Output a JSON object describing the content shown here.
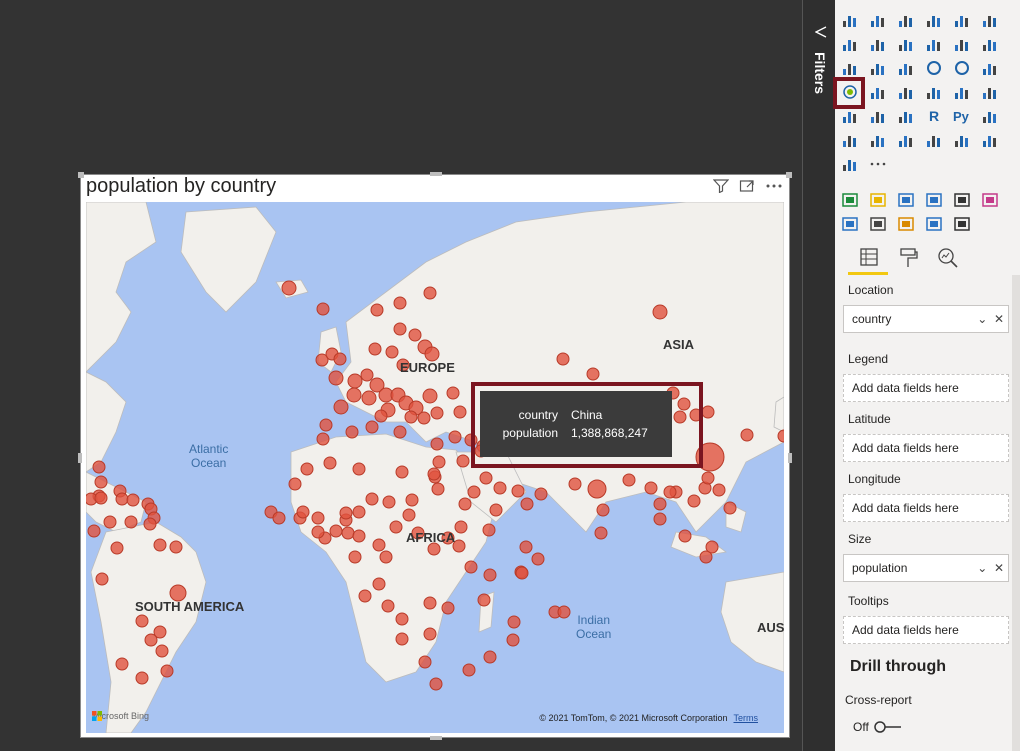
{
  "visual": {
    "title": "population by country",
    "icons": [
      "filter-icon",
      "focus-mode-icon",
      "more-options-icon"
    ]
  },
  "map": {
    "continents": [
      "EUROPE",
      "ASIA",
      "AFRICA",
      "SOUTH AMERICA",
      "AUST"
    ],
    "oceans": [
      {
        "line1": "Atlantic",
        "line2": "Ocean"
      },
      {
        "line1": "Indian",
        "line2": "Ocean"
      }
    ],
    "bing_text": "Microsoft Bing",
    "copyright": "© 2021 TomTom, © 2021 Microsoft Corporation",
    "terms": "Terms",
    "bubble_color": "#e0533e"
  },
  "tooltip": {
    "rows": [
      {
        "key": "country",
        "value": "China"
      },
      {
        "key": "population",
        "value": "1,388,868,247"
      }
    ]
  },
  "filters": {
    "label": "Filters"
  },
  "visualizations": {
    "fields_label": "Location",
    "sections": [
      {
        "label": "Location",
        "value": "country",
        "filled": true
      },
      {
        "label": "Legend",
        "value": "Add data fields here",
        "filled": false
      },
      {
        "label": "Latitude",
        "value": "Add data fields here",
        "filled": false
      },
      {
        "label": "Longitude",
        "value": "Add data fields here",
        "filled": false
      },
      {
        "label": "Size",
        "value": "population",
        "filled": true
      },
      {
        "label": "Tooltips",
        "value": "Add data fields here",
        "filled": false
      }
    ],
    "drill_through": "Drill through",
    "cross_report": "Cross-report",
    "toggle_label": "Off",
    "selected_visual": "map-visual-icon",
    "accent": "#7b1520",
    "tab_underline": "#f2c811"
  }
}
